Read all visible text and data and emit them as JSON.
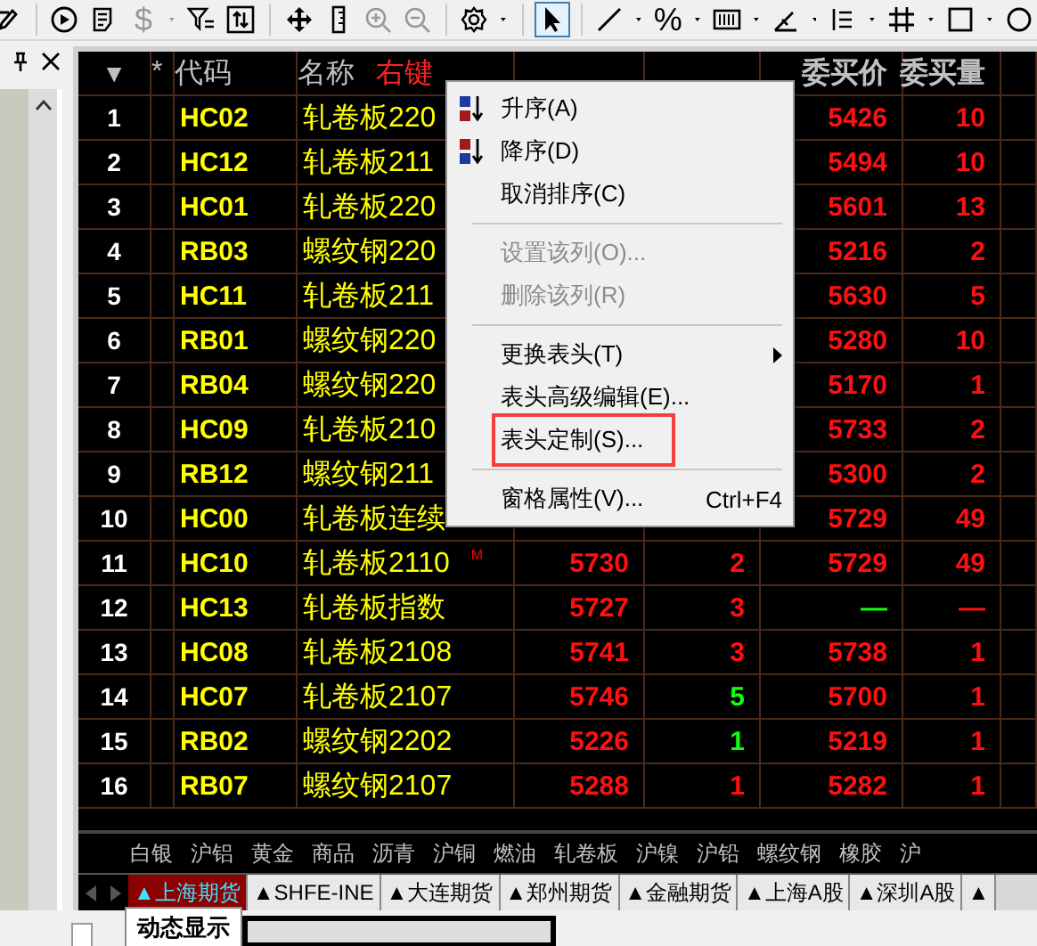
{
  "toolbar": [
    {
      "kind": "edit"
    },
    {
      "kind": "sep"
    },
    {
      "kind": "play"
    },
    {
      "kind": "doc"
    },
    {
      "kind": "char",
      "label": "$",
      "disabled": true,
      "dropdown": true
    },
    {
      "kind": "filter"
    },
    {
      "kind": "sort"
    },
    {
      "kind": "sep"
    },
    {
      "kind": "move"
    },
    {
      "kind": "ruler"
    },
    {
      "kind": "zoomin",
      "disabled": true
    },
    {
      "kind": "zoomout",
      "disabled": true
    },
    {
      "kind": "sep"
    },
    {
      "kind": "gear",
      "dropdown": true
    },
    {
      "kind": "sep"
    },
    {
      "kind": "cursor",
      "selected": true
    },
    {
      "kind": "sep"
    },
    {
      "kind": "line",
      "dropdown": true
    },
    {
      "kind": "char",
      "label": "%",
      "dropdown": true
    },
    {
      "kind": "bars",
      "dropdown": true
    },
    {
      "kind": "angle",
      "dropdown": true
    },
    {
      "kind": "list",
      "dropdown": true
    },
    {
      "kind": "grid",
      "dropdown": true
    },
    {
      "kind": "square",
      "dropdown": true
    },
    {
      "kind": "circle"
    }
  ],
  "header": {
    "sort_caret": "▼",
    "star": "*",
    "code": "代码",
    "name": "名称",
    "hint": "右键",
    "bid_price": "委买价",
    "bid_volume": "委买量"
  },
  "rows": [
    {
      "index": "1",
      "code": "HC02",
      "name": "轧卷板220",
      "bid_price": "5426",
      "bid_volume": "10",
      "bid_up": true
    },
    {
      "index": "2",
      "code": "HC12",
      "name": "轧卷板211",
      "bid_price": "5494",
      "bid_volume": "10",
      "bid_up": true
    },
    {
      "index": "3",
      "code": "HC01",
      "name": "轧卷板220",
      "bid_price": "5601",
      "bid_volume": "13",
      "bid_up": true
    },
    {
      "index": "4",
      "code": "RB03",
      "name": "螺纹钢220",
      "bid_price": "5216",
      "bid_volume": "2",
      "bid_up": true
    },
    {
      "index": "5",
      "code": "HC11",
      "name": "轧卷板211",
      "bid_price": "5630",
      "bid_volume": "5",
      "bid_up": true
    },
    {
      "index": "6",
      "code": "RB01",
      "name": "螺纹钢220",
      "bid_price": "5280",
      "bid_volume": "10",
      "bid_up": true
    },
    {
      "index": "7",
      "code": "RB04",
      "name": "螺纹钢220",
      "bid_price": "5170",
      "bid_volume": "1",
      "bid_up": true
    },
    {
      "index": "8",
      "code": "HC09",
      "name": "轧卷板210",
      "bid_price": "5733",
      "bid_volume": "2",
      "bid_up": true
    },
    {
      "index": "9",
      "code": "RB12",
      "name": "螺纹钢211",
      "bid_price": "5300",
      "bid_volume": "2",
      "bid_up": true
    },
    {
      "index": "10",
      "code": "HC00",
      "name": "轧卷板连续",
      "bid_price": "5729",
      "bid_volume": "49",
      "bid_up": true
    },
    {
      "index": "11",
      "code": "HC10",
      "name": "轧卷板2110",
      "mark": "M",
      "latest": "5730",
      "hand": "2",
      "bid_price": "5729",
      "bid_volume": "49",
      "hand_up": false,
      "bid_up": true
    },
    {
      "index": "12",
      "code": "HC13",
      "name": "轧卷板指数",
      "latest": "5727",
      "hand": "3",
      "bid_price": "—",
      "bid_volume": "—",
      "hand_up": false,
      "bid_up": false
    },
    {
      "index": "13",
      "code": "HC08",
      "name": "轧卷板2108",
      "latest": "5741",
      "hand": "3",
      "bid_price": "5738",
      "bid_volume": "1",
      "hand_up": false,
      "bid_up": true
    },
    {
      "index": "14",
      "code": "HC07",
      "name": "轧卷板2107",
      "latest": "5746",
      "hand": "5",
      "bid_price": "5700",
      "bid_volume": "1",
      "hand_up": true,
      "bid_up": true
    },
    {
      "index": "15",
      "code": "RB02",
      "name": "螺纹钢2202",
      "latest": "5226",
      "hand": "1",
      "bid_price": "5219",
      "bid_volume": "1",
      "hand_up": true,
      "bid_up": true
    },
    {
      "index": "16",
      "code": "RB07",
      "name": "螺纹钢2107",
      "latest": "5288",
      "hand": "1",
      "bid_price": "5282",
      "bid_volume": "1",
      "hand_up": false,
      "bid_up": true
    }
  ],
  "categories": [
    "白银",
    "沪铝",
    "黄金",
    "商品",
    "沥青",
    "沪铜",
    "燃油",
    "轧卷板",
    "沪镍",
    "沪铅",
    "螺纹钢",
    "橡胶",
    "沪"
  ],
  "market_tabs": [
    {
      "label": "▲上海期货",
      "selected": true
    },
    {
      "label": "▲SHFE-INE",
      "selected": false
    },
    {
      "label": "▲大连期货",
      "selected": false
    },
    {
      "label": "▲郑州期货",
      "selected": false
    },
    {
      "label": "▲金融期货",
      "selected": false
    },
    {
      "label": "▲上海A股",
      "selected": false
    },
    {
      "label": "▲深圳A股",
      "selected": false
    },
    {
      "label": "▲",
      "selected": false
    }
  ],
  "bottom_tab": "动态显示",
  "context_menu": [
    {
      "kind": "sort_ascending",
      "label": "升序(A)",
      "disabled": false,
      "highlighted": false
    },
    {
      "kind": "sort_descending",
      "label": "降序(D)",
      "disabled": false,
      "highlighted": false
    },
    {
      "kind": "item",
      "label": "取消排序(C)",
      "disabled": false,
      "highlighted": false
    },
    {
      "kind": "separator"
    },
    {
      "kind": "item",
      "label": "设置该列(O)...",
      "disabled": true,
      "highlighted": false
    },
    {
      "kind": "item",
      "label": "删除该列(R)",
      "disabled": true,
      "highlighted": false
    },
    {
      "kind": "separator"
    },
    {
      "kind": "item",
      "label": "更换表头(T)",
      "submenu": true,
      "disabled": false,
      "highlighted": false
    },
    {
      "kind": "item",
      "label": "表头高级编辑(E)...",
      "disabled": false,
      "highlighted": false
    },
    {
      "kind": "item",
      "label": "表头定制(S)...",
      "disabled": false,
      "highlighted": true
    },
    {
      "kind": "separator"
    },
    {
      "kind": "item",
      "label": "窗格属性(V)...",
      "shortcut": "Ctrl+F4",
      "disabled": false,
      "highlighted": false
    }
  ]
}
